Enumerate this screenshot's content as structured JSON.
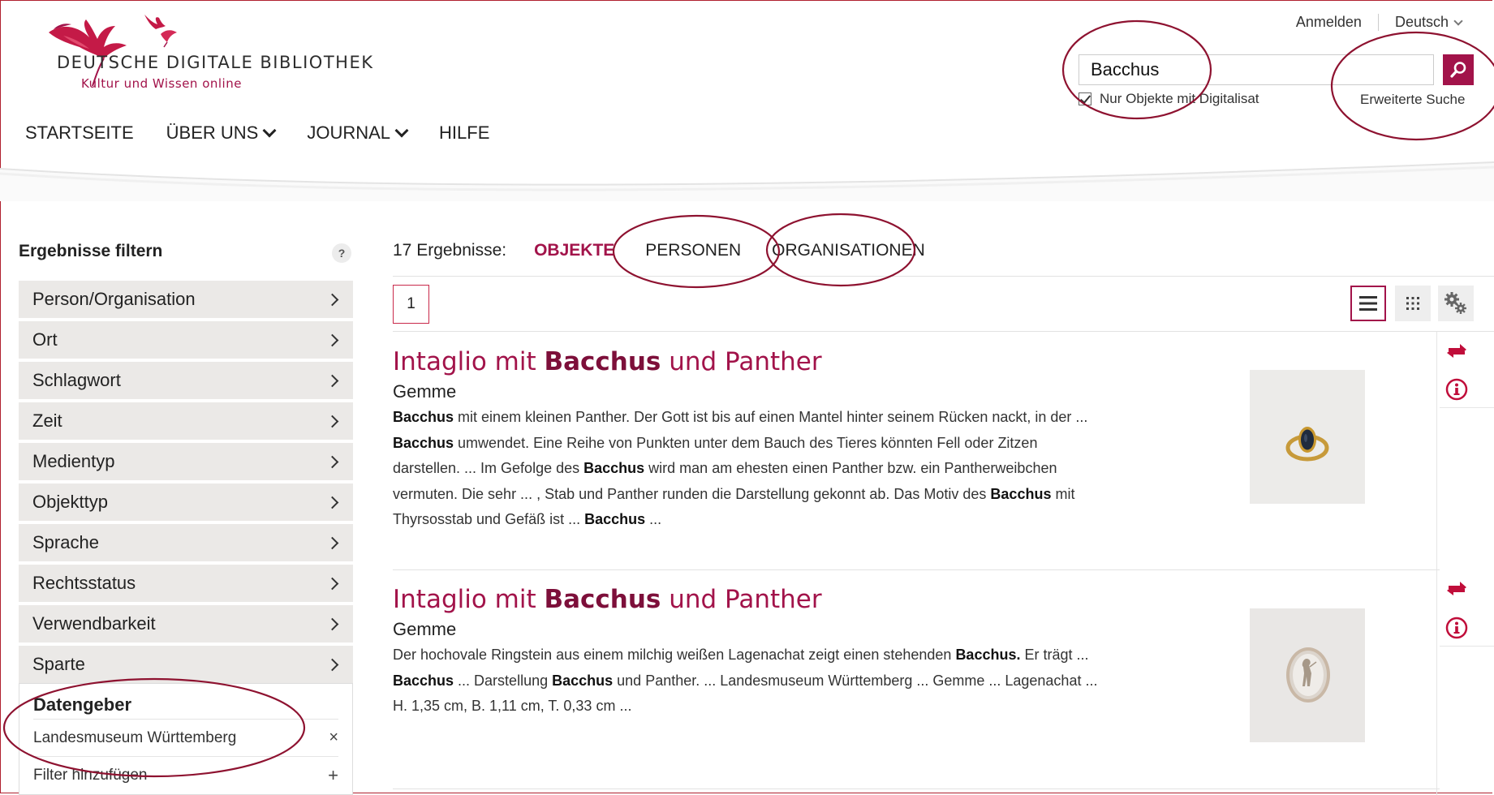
{
  "brand": {
    "title": "DEUTSCHE DIGITALE BIBLIOTHEK",
    "subtitle": "Kultur und Wissen online",
    "accent": "#a2134a"
  },
  "topbar": {
    "login": "Anmelden",
    "language": "Deutsch"
  },
  "nav": [
    "STARTSEITE",
    "ÜBER UNS",
    "JOURNAL",
    "HILFE"
  ],
  "search": {
    "value": "Bacchus",
    "checkbox_label": "Nur Objekte mit Digitalisat",
    "checkbox_checked": true,
    "advanced": "Erweiterte Suche"
  },
  "sidebar": {
    "title": "Ergebnisse filtern",
    "help": "?",
    "facets": [
      "Person/Organisation",
      "Ort",
      "Schlagwort",
      "Zeit",
      "Medientyp",
      "Objekttyp",
      "Sprache",
      "Rechtsstatus",
      "Verwendbarkeit",
      "Sparte"
    ],
    "provider": {
      "title": "Datengeber",
      "selected": "Landesmuseum Württemberg",
      "remove": "×",
      "add_label": "Filter hinzufügen",
      "add": "+"
    }
  },
  "results": {
    "count_label": "17 Ergebnisse:",
    "tabs": [
      "OBJEKTE",
      "PERSONEN",
      "ORGANISATIONEN"
    ],
    "active_tab": "OBJEKTE",
    "page": "1",
    "items": [
      {
        "title_pre": "Intaglio mit ",
        "title_bold": "Bacchus",
        "title_post": " und Panther",
        "type": "Gemme",
        "snippet_html": "<b>Bacchus</b> mit einem kleinen Panther. Der Gott ist bis auf einen Mantel hinter seinem Rücken nackt, in der ... <b>Bacchus</b> umwendet. Eine Reihe von Punkten unter dem Bauch des Tieres könnten Fell oder Zitzen darstellen. ... Im Gefolge des <b>Bacchus</b> wird man am ehesten einen Panther bzw. ein Pantherweibchen vermuten. Die sehr ... , Stab und Panther runden die Darstellung gekonnt ab. Das Motiv des <b>Bacchus</b> mit Thyrsosstab und Gefäß ist ... <b>Bacchus</b> ..."
      },
      {
        "title_pre": "Intaglio mit ",
        "title_bold": "Bacchus",
        "title_post": " und Panther",
        "type": "Gemme",
        "snippet_html": "Der hochovale Ringstein aus einem milchig weißen Lagenachat zeigt einen stehenden <b>Bacchus.</b> Er trägt ... <b>Bacchus</b> ... Darstellung <b>Bacchus</b> und Panther. ... Landesmuseum Württemberg ... Gemme ... Lagenachat ... H. 1,35 cm, B. 1,11 cm, T. 0,33 cm ..."
      }
    ]
  },
  "icons": [
    "search-icon",
    "list-view-icon",
    "grid-view-icon",
    "settings-gears-icon",
    "compare-arrows-icon",
    "info-icon",
    "close-icon",
    "plus-icon"
  ]
}
